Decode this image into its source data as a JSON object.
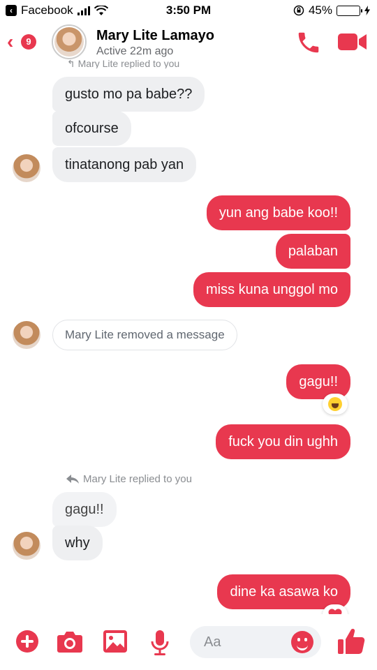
{
  "status_bar": {
    "app_back": "Facebook",
    "time": "3:50 PM",
    "battery": "45%",
    "battery_level": 0.45
  },
  "header": {
    "unread_count": "9",
    "contact_name": "Mary Lite Lamayo",
    "active_status": "Active 22m ago",
    "reply_notice_top": "Mary Lite replied to you"
  },
  "messages": [
    {
      "text": "gusto mo pa babe??"
    },
    {
      "text": "ofcourse"
    },
    {
      "text": "tinatanong pab yan"
    },
    {
      "text": "yun ang babe koo!!"
    },
    {
      "text": "palaban"
    },
    {
      "text": "miss kuna unggol mo"
    },
    {
      "text": "Mary Lite removed a message"
    },
    {
      "text": "gagu!!"
    },
    {
      "text": "fuck you din ughh"
    },
    {
      "text": "Mary Lite replied to you"
    },
    {
      "text": "gagu!!"
    },
    {
      "text": "why"
    },
    {
      "text": "dine ka asawa ko"
    }
  ],
  "composer": {
    "placeholder": "Aa"
  },
  "colors": {
    "accent": "#e8384f",
    "incoming_bubble": "#eeeff1"
  }
}
